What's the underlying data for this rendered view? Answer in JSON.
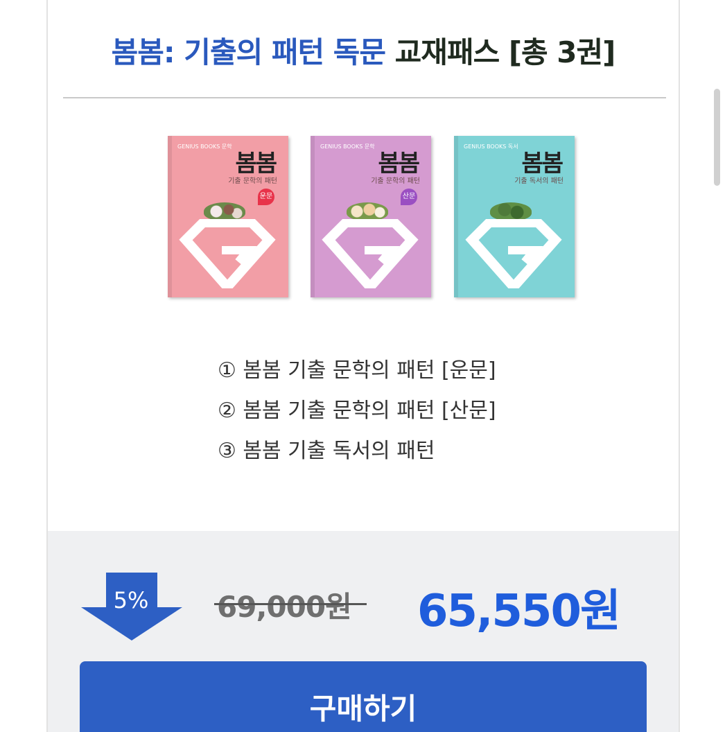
{
  "title": {
    "part_blue": "봄봄: 기출의 패턴 독문",
    "part_dark": "교재패스 [총 3권]"
  },
  "books": [
    {
      "pub": "GENIUS BOOKS 문학",
      "title": "봄봄",
      "subtitle": "기출 문학의 패턴",
      "tag": "운문",
      "color": "#f29ea6",
      "tag_color": "#e8334a"
    },
    {
      "pub": "GENIUS BOOKS 문학",
      "title": "봄봄",
      "subtitle": "기출 문학의 패턴",
      "tag": "산문",
      "color": "#d59bd0",
      "tag_color": "#9a4fc2"
    },
    {
      "pub": "GENIUS BOOKS 독서",
      "title": "봄봄",
      "subtitle": "기출 독서의 패턴",
      "tag": "",
      "color": "#7fd3d6",
      "tag_color": ""
    }
  ],
  "items": [
    "① 봄봄 기출 문학의 패턴 [운문]",
    "② 봄봄 기출 문학의 패턴 [산문]",
    "③ 봄봄 기출 독서의 패턴"
  ],
  "price": {
    "discount": "5%",
    "original": "69,000원",
    "sale": "65,550원"
  },
  "buy_label": "구매하기",
  "colors": {
    "accent": "#2d5fc4",
    "title_blue": "#2a59bd",
    "sale_blue": "#1f5ddc",
    "band": "#eff0f2"
  }
}
